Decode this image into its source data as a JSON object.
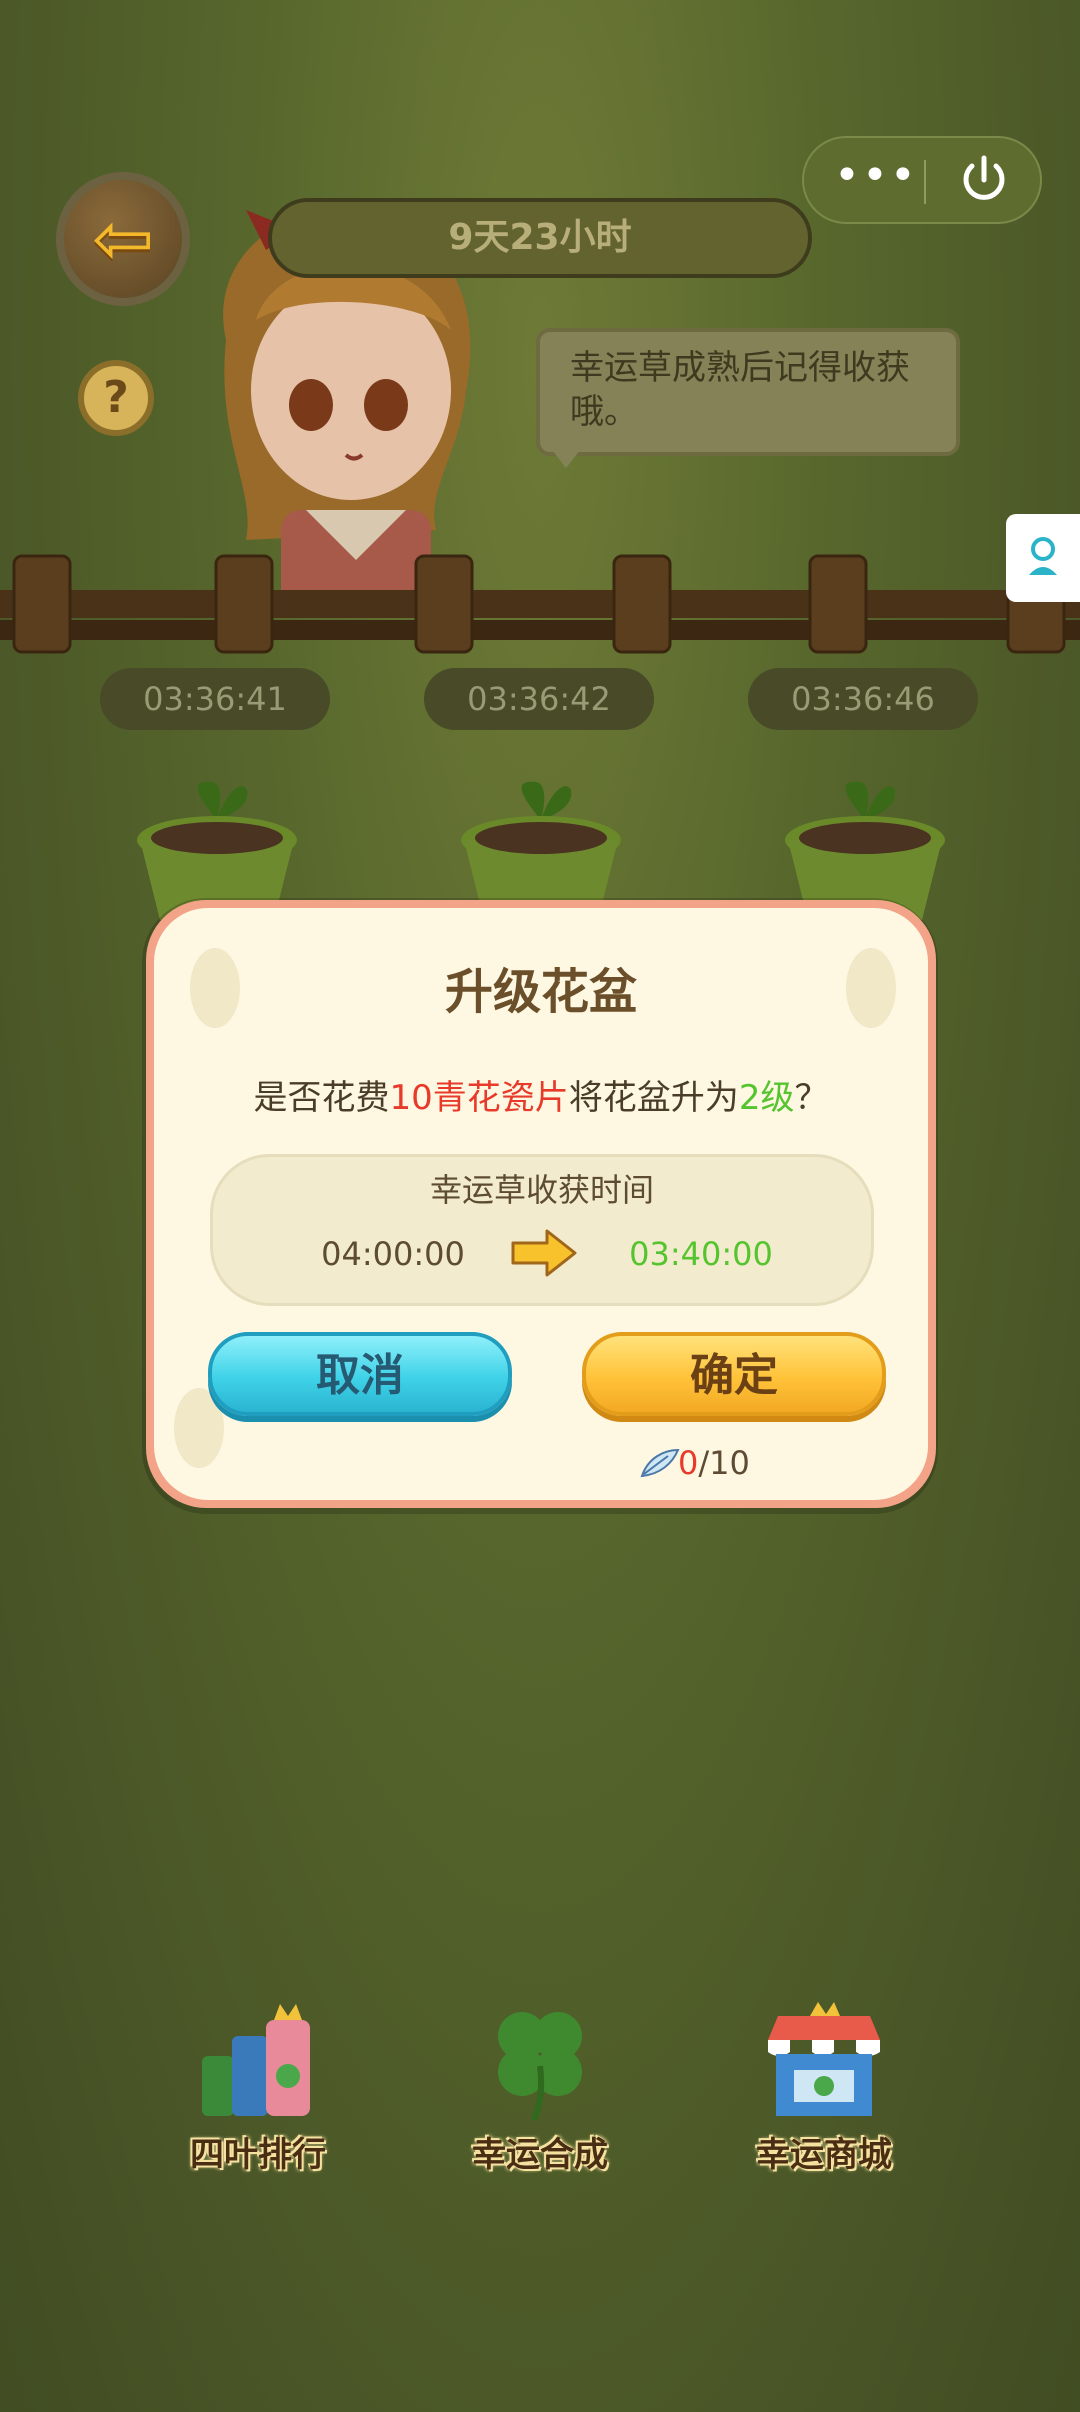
{
  "header": {
    "countdown": "9天23小时",
    "menu_dots": "•••"
  },
  "speech": {
    "text": "幸运草成熟后记得收获哦。"
  },
  "pots": [
    {
      "timer": "03:36:41"
    },
    {
      "timer": "03:36:42"
    },
    {
      "timer": "03:36:46"
    }
  ],
  "dialog": {
    "title": "升级花盆",
    "question_prefix": "是否花费",
    "cost": "10青花瓷片",
    "question_middle": "将花盆升为",
    "level": "2级",
    "question_suffix": "？",
    "time_label": "幸运草收获时间",
    "old_time": "04:00:00",
    "new_time": "03:40:00",
    "cancel_label": "取消",
    "confirm_label": "确定",
    "owned": "0",
    "required": "/10"
  },
  "bottom_nav": [
    {
      "label": "四叶排行",
      "icon": "ranking-icon"
    },
    {
      "label": "幸运合成",
      "icon": "clover-icon"
    },
    {
      "label": "幸运商城",
      "icon": "shop-icon"
    }
  ],
  "colors": {
    "cost": "#e83a2a",
    "level": "#56c42e",
    "cancel": "#3fd2e8",
    "confirm": "#ffc33a"
  }
}
